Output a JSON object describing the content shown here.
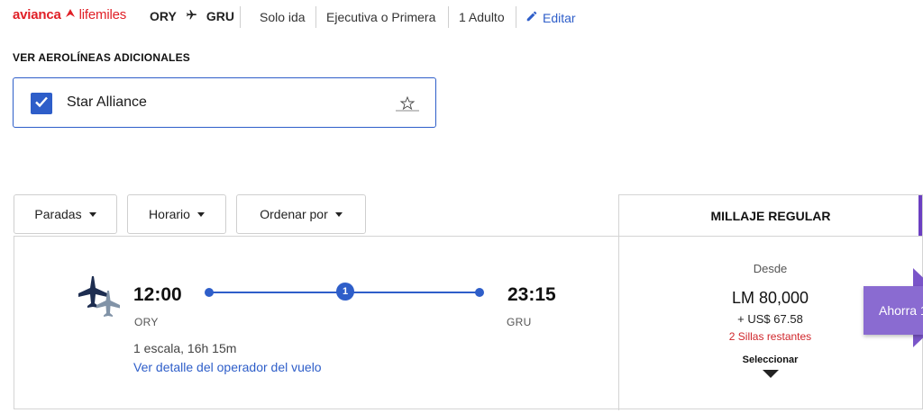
{
  "header": {
    "brand_avianca": "avianca",
    "brand_lifemiles": "lifemiles",
    "origin": "ORY",
    "destination": "GRU",
    "trip_type": "Solo ida",
    "cabin": "Ejecutiva o Primera",
    "passengers": "1 Adulto",
    "edit_label": "Editar"
  },
  "airlines": {
    "section_title": "VER AEROLÍNEAS ADICIONALES",
    "alliance_label": "Star Alliance",
    "alliance_checked": true,
    "alliance_icon": "star-alliance-logo"
  },
  "filters": [
    {
      "label": "Paradas"
    },
    {
      "label": "Horario"
    },
    {
      "label": "Ordenar por"
    }
  ],
  "fare_column": {
    "header": "MILLAJE REGULAR",
    "accent_color": "#6b3fc1"
  },
  "flight": {
    "departure_time": "12:00",
    "departure_airport": "ORY",
    "arrival_time": "23:15",
    "arrival_airport": "GRU",
    "stops_count": "1",
    "stops_duration": "1 escala, 16h 15m",
    "operator_link": "Ver detalle del operador del vuelo",
    "fare": {
      "from_label": "Desde",
      "miles": "LM 80,000",
      "taxes": "+ US$ 67.58",
      "seats_left": "2 Sillas restantes",
      "select_label": "Seleccionar"
    },
    "promo_label": "Ahorra 1"
  },
  "colors": {
    "brand_red": "#e01f26",
    "link_blue": "#2e5ec9",
    "promo_purple": "#8a6bd1",
    "seats_red": "#d0262b"
  }
}
